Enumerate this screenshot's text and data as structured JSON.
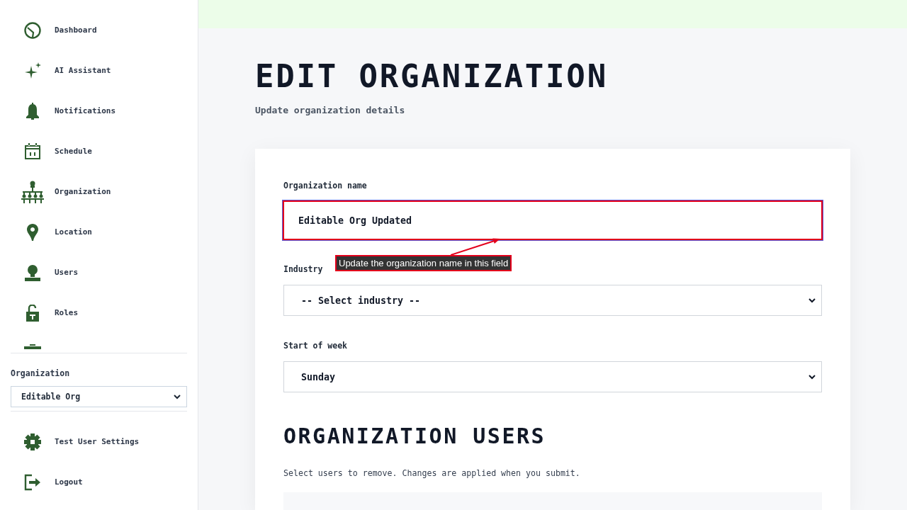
{
  "sidebar": {
    "nav_items": [
      {
        "label": "Dashboard"
      },
      {
        "label": "AI Assistant"
      },
      {
        "label": "Notifications"
      },
      {
        "label": "Schedule"
      },
      {
        "label": "Organization"
      },
      {
        "label": "Location"
      },
      {
        "label": "Users"
      },
      {
        "label": "Roles"
      }
    ],
    "organization_select": {
      "label": "Organization",
      "value": "Editable Org"
    },
    "footer_items": [
      {
        "label": "Test User Settings"
      },
      {
        "label": "Logout"
      }
    ]
  },
  "header": {
    "title": "EDIT ORGANIZATION",
    "subtitle": "Update organization details"
  },
  "form": {
    "fields": [
      {
        "kind": "text",
        "label": "Organization name",
        "value": "Editable Org Updated",
        "focused": true,
        "highlighted": true
      },
      {
        "kind": "select",
        "label": "Industry",
        "value": "-- Select industry --",
        "focused": false,
        "highlighted": false
      },
      {
        "kind": "select",
        "label": "Start of week",
        "value": "Sunday",
        "focused": false,
        "highlighted": false
      }
    ]
  },
  "annotation": {
    "text": "Update the organization name in this field"
  },
  "users_section": {
    "title": "ORGANIZATION USERS",
    "description": "Select users to remove. Changes are applied when you submit."
  }
}
